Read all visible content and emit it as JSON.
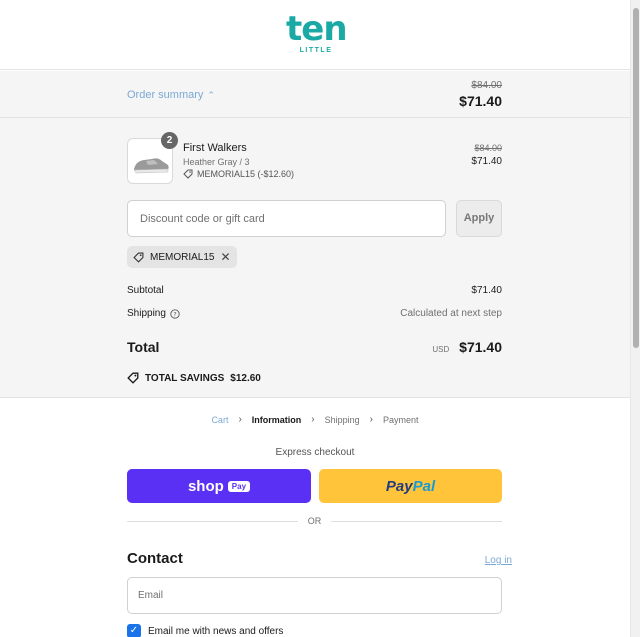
{
  "brand": {
    "name": "ten",
    "sub": "LITTLE"
  },
  "summary": {
    "toggle_label": "Order summary",
    "original_total": "$84.00",
    "total": "$71.40"
  },
  "product": {
    "quantity": "2",
    "name": "First Walkers",
    "variant": "Heather Gray / 3",
    "discount": "MEMORIAL15 (-$12.60)",
    "original_price": "$84.00",
    "price": "$71.40"
  },
  "discount": {
    "placeholder": "Discount code or gift card",
    "apply_label": "Apply",
    "applied_code": "MEMORIAL15"
  },
  "totals": {
    "subtotal_label": "Subtotal",
    "subtotal": "$71.40",
    "shipping_label": "Shipping",
    "shipping_value": "Calculated at next step",
    "total_label": "Total",
    "currency": "USD",
    "total": "$71.40",
    "savings_label": "TOTAL SAVINGS",
    "savings": "$12.60"
  },
  "breadcrumb": [
    "Cart",
    "Information",
    "Shipping",
    "Payment"
  ],
  "express": {
    "label": "Express checkout",
    "shop_label": "shop",
    "shop_pay": "Pay",
    "paypal_a": "Pay",
    "paypal_b": "Pal",
    "or": "OR"
  },
  "contact": {
    "title": "Contact",
    "login": "Log in",
    "email_placeholder": "Email",
    "news_label": "Email me with news and offers"
  },
  "colors": {
    "brand": "#1aa9a4",
    "shop_pay": "#5a31f4",
    "paypal": "#ffc439",
    "link": "#7aa9d6"
  }
}
